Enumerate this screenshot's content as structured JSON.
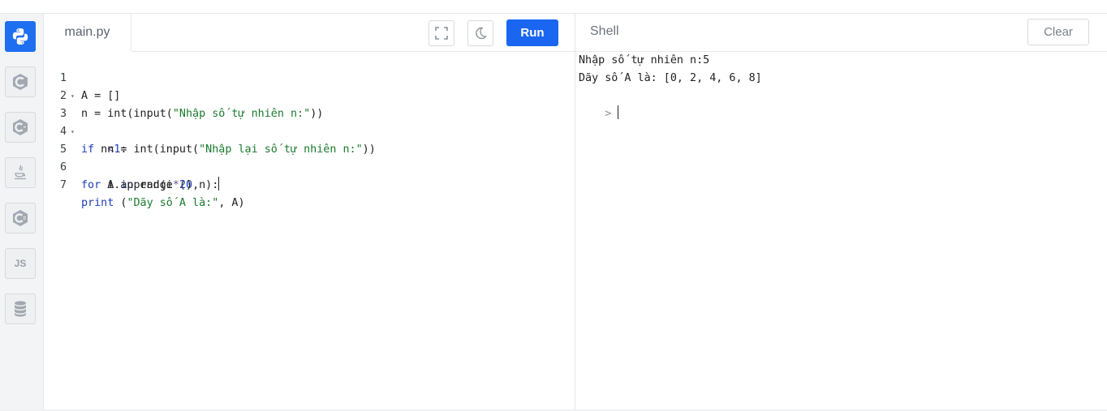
{
  "sidebar": {
    "items": [
      {
        "name": "python-icon",
        "active": true
      },
      {
        "name": "c-icon"
      },
      {
        "name": "cpp-icon"
      },
      {
        "name": "java-icon"
      },
      {
        "name": "csharp-icon"
      },
      {
        "label": "JS"
      },
      {
        "name": "database-icon"
      }
    ]
  },
  "editor": {
    "tab_label": "main.py",
    "run_label": "Run",
    "lines": [
      {
        "n": "1",
        "text": "A = []"
      },
      {
        "n": "2",
        "text": "n = int(input(\"Nhập số tự nhiên n:\"))"
      },
      {
        "n": "3",
        "text": "if n<1:"
      },
      {
        "n": "4",
        "text": "    n = int(input(\"Nhập lại số tự nhiên n:\"))"
      },
      {
        "n": "5",
        "text": "for i in range (0,n):"
      },
      {
        "n": "6",
        "text": "    A.append(i*2)"
      },
      {
        "n": "7",
        "text": "print (\"Dãy số A là:\", A)"
      }
    ]
  },
  "shell": {
    "title": "Shell",
    "clear_label": "Clear",
    "output": [
      "Nhập số tự nhiên n:5",
      "Dãy số A là: [0, 2, 4, 6, 8]"
    ],
    "prompt": ">"
  },
  "colors": {
    "accent": "#1a66f0",
    "keyword": "#1f3fb8",
    "string": "#1b7a2d"
  }
}
